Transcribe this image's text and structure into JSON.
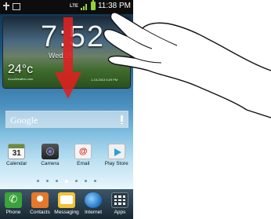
{
  "status_bar": {
    "network": "LTE",
    "time": "11:38 PM"
  },
  "widget": {
    "clock": "7:52",
    "date": "Wed  15",
    "temperature": "24°c",
    "credit": "AccuWeather.com",
    "updated": "1-15-2013 5:29 PM"
  },
  "search": {
    "label": "Google"
  },
  "apps": [
    {
      "label": "Calendar",
      "icon": "calendar-icon",
      "badge": "31"
    },
    {
      "label": "Camera",
      "icon": "camera-icon"
    },
    {
      "label": "Email",
      "icon": "email-icon"
    },
    {
      "label": "Play Store",
      "icon": "play-store-icon"
    }
  ],
  "dock": [
    {
      "label": "Phone",
      "icon": "phone-icon"
    },
    {
      "label": "Contacts",
      "icon": "contacts-icon"
    },
    {
      "label": "Messaging",
      "icon": "messaging-icon"
    },
    {
      "label": "Internet",
      "icon": "internet-icon"
    },
    {
      "label": "Apps",
      "icon": "apps-grid-icon"
    }
  ],
  "colors": {
    "arrow": "#e02020",
    "accent_green": "#8fd23a"
  }
}
